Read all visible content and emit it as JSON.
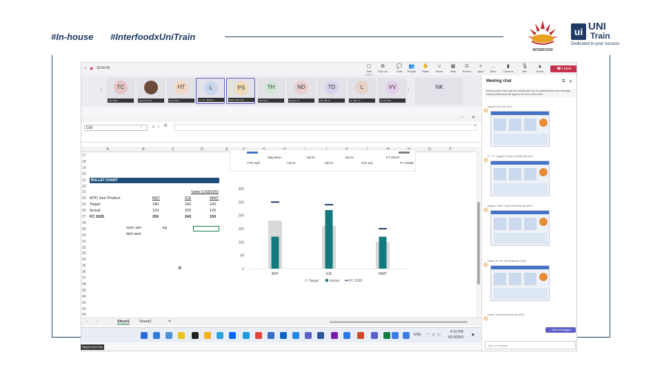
{
  "header": {
    "hashtag1": "#In-house",
    "hashtag2": "#InterfoodxUniTrain"
  },
  "logos": {
    "interfood_label": "INTERFOOD",
    "uni_line1": "UNI",
    "uni_line2": "Train",
    "uni_tagline": "Dedicated to your success"
  },
  "meeting": {
    "timer": "33:42:42",
    "toolbar": [
      {
        "label": "Take control",
        "icon": "▢"
      },
      {
        "label": "Pop out",
        "icon": "⧉"
      },
      {
        "label": "Chat",
        "icon": "💬"
      },
      {
        "label": "People",
        "icon": "👥"
      },
      {
        "label": "Raise",
        "icon": "✋"
      },
      {
        "label": "React",
        "icon": "☺"
      },
      {
        "label": "View",
        "icon": "▦"
      },
      {
        "label": "Rooms",
        "icon": "⊡"
      },
      {
        "label": "Apps",
        "icon": "+"
      },
      {
        "label": "More",
        "icon": "…"
      },
      {
        "label": "Camera",
        "icon": "▮"
      },
      {
        "label": "Mic",
        "icon": "🎙"
      },
      {
        "label": "Share",
        "icon": "▲"
      }
    ],
    "people_count": "20",
    "leave_label": "Leave",
    "participants": [
      {
        "initials": "TC",
        "name": "Tran Minh ...",
        "color": "#e7c4c4"
      },
      {
        "initials": "",
        "name": "Nguyen Anh D...",
        "color": "#6b4a3a"
      },
      {
        "initials": "HT",
        "name": "Huynh Nhu ...",
        "color": "#f1d9c4"
      },
      {
        "initials": "L",
        "name": "LT - IF - Nguyen...",
        "color": "#c9d7ee"
      },
      {
        "initials": "PS",
        "name": "Pham Xuan Son...",
        "color": "#f2dcb8"
      },
      {
        "initials": "TH",
        "name": "Tran Thuy ...",
        "color": "#cfe8d6"
      },
      {
        "initials": "ND",
        "name": "Nguyen Th...",
        "color": "#e9cfcf"
      },
      {
        "initials": "TD",
        "name": "Tran Van D...",
        "color": "#d9d4ee"
      },
      {
        "initials": "L",
        "name": "LT - HR - Tr...",
        "color": "#e7d2c8"
      },
      {
        "initials": "VV",
        "name": "Vo Thi Thuo...",
        "color": "#e2d0ea"
      },
      {
        "initials": "NK",
        "name": "",
        "color": "#e4e0ec"
      }
    ]
  },
  "excel": {
    "name_box": "D29",
    "fx": "fx",
    "columns": [
      "A",
      "B",
      "C",
      "D",
      "E",
      "F",
      "G",
      "H",
      "I",
      "J",
      "K",
      "L",
      "M",
      "N",
      "O",
      "P"
    ],
    "rows": [
      "17",
      "18",
      "19",
      "20",
      "21",
      "22",
      "23",
      "24",
      "25",
      "26",
      "27",
      "28",
      "29",
      "30",
      "31",
      "32",
      "33",
      "34",
      "35",
      "36",
      "37",
      "38",
      "39",
      "40",
      "41",
      "42",
      "43"
    ],
    "bullet_title": "BULLET CHART",
    "sales_label": "Sales (US$'000)",
    "table": {
      "header": [
        "MTD Jun/ Product",
        "BNT",
        "ICE",
        "WMT"
      ],
      "rows": [
        [
          "Target",
          "180",
          "160",
          "100"
        ],
        [
          "Actual",
          "120",
          "220",
          "120"
        ],
        [
          "FC 2025",
          "250",
          "240",
          "150"
        ]
      ]
    },
    "notes": {
      "nuoc_yen": "nuoc yen",
      "kg": "kg",
      "bird_nest": "bird nest"
    },
    "strip_labels": [
      "May-Best...",
      "Adj #2",
      "Adj #4",
      "FY 2024F",
      "YTD April",
      "Adj #1",
      "Adj #3",
      "Kick adj.",
      "FY 2029E"
    ],
    "sheets": [
      "Sheet1",
      "Sheet2"
    ]
  },
  "chart_data": {
    "type": "bar",
    "categories": [
      "BNT",
      "ICE",
      "WMT"
    ],
    "series": [
      {
        "name": "Target",
        "values": [
          180,
          160,
          100
        ]
      },
      {
        "name": "Actual",
        "values": [
          120,
          220,
          120
        ]
      },
      {
        "name": "FC 2025",
        "values": [
          250,
          240,
          150
        ]
      }
    ],
    "ylim": [
      0,
      300
    ],
    "yticks": [
      "0",
      "50",
      "100",
      "150",
      "200",
      "250",
      "300"
    ],
    "legend": "bottom",
    "colors": {
      "Target": "#d9d9d9",
      "Actual": "#127a7f",
      "FC 2025": "#1f3b63"
    }
  },
  "taskbar": {
    "lang": "ENG",
    "time": "4:16 PM",
    "date": "8/13/2025",
    "presenter": "Nguyen Anh Dao"
  },
  "chat": {
    "title": "Meeting chat",
    "note": "Some people in this chat are outside your org. It's possible they have message-related policies that will apply to the chat. Learn more",
    "messages": [
      {
        "sender": "Nguyen Anh Dao",
        "time": "16:01"
      },
      {
        "sender": "LT - IF - Nguyen Hoang Vi (External)",
        "time": "16:02"
      },
      {
        "sender": "Nguyen Thanh Tuyet Van (External)",
        "time": "16:03"
      },
      {
        "sender": "Hoang Thi Thu Van (External)",
        "time": "16:03"
      },
      {
        "sender": "Huynh Thanh Dat (External)",
        "time": "16:03"
      }
    ],
    "new_messages": "New messages",
    "input_placeholder": "Type a message"
  }
}
